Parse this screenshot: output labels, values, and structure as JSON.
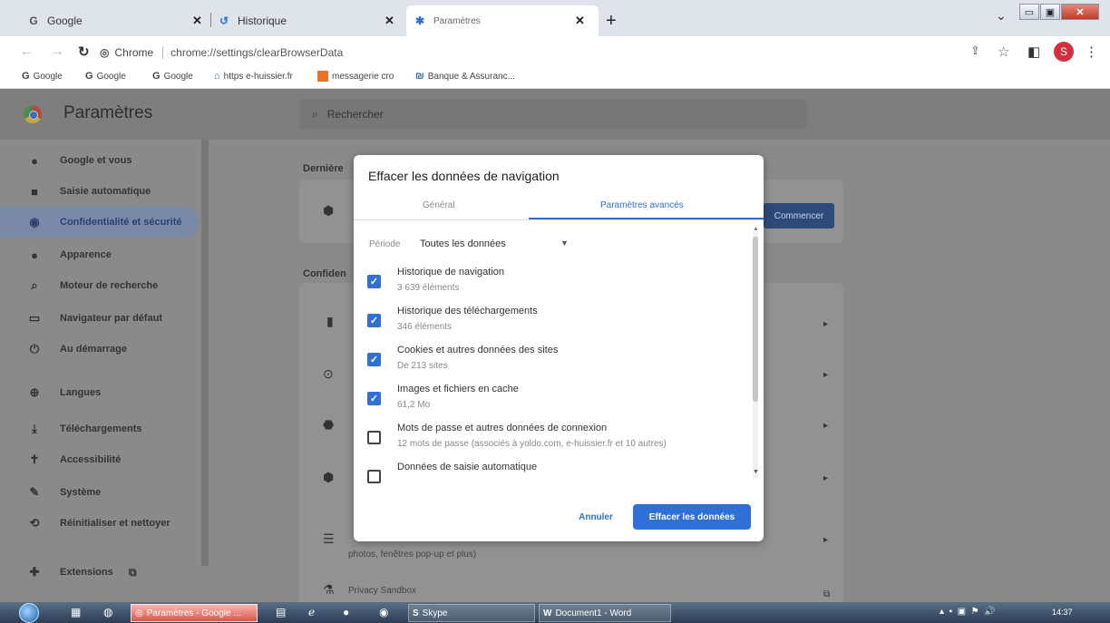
{
  "tabs": [
    {
      "title": "Google",
      "icon": "google-icon"
    },
    {
      "title": "Historique",
      "icon": "history-icon"
    },
    {
      "title": "Paramètres",
      "icon": "gear-icon"
    }
  ],
  "omnibox": {
    "site": "Chrome",
    "url": "chrome://settings/clearBrowserData"
  },
  "profile": {
    "initial": "S"
  },
  "bookmarks": [
    {
      "label": "Google"
    },
    {
      "label": "Google"
    },
    {
      "label": "Google"
    },
    {
      "label": "https e-huissier.fr"
    },
    {
      "label": "messagerie cro"
    },
    {
      "label": "Banque & Assuranc..."
    }
  ],
  "settings": {
    "title": "Paramètres",
    "search_placeholder": "Rechercher",
    "nav": [
      {
        "label": "Google et vous",
        "icon": "person-icon"
      },
      {
        "label": "Saisie automatique",
        "icon": "clipboard-icon"
      },
      {
        "label": "Confidentialité et sécurité",
        "icon": "shield-icon"
      },
      {
        "label": "Apparence",
        "icon": "palette-icon"
      },
      {
        "label": "Moteur de recherche",
        "icon": "search-icon"
      },
      {
        "label": "Navigateur par défaut",
        "icon": "browser-icon"
      },
      {
        "label": "Au démarrage",
        "icon": "power-icon"
      },
      {
        "label": "Langues",
        "icon": "globe-icon"
      },
      {
        "label": "Téléchargements",
        "icon": "download-icon"
      },
      {
        "label": "Accessibilité",
        "icon": "accessibility-icon"
      },
      {
        "label": "Système",
        "icon": "wrench-icon"
      },
      {
        "label": "Réinitialiser et nettoyer",
        "icon": "reset-icon"
      },
      {
        "label": "Extensions",
        "icon": "puzzle-icon"
      }
    ],
    "sections": [
      {
        "title": "Dernière"
      },
      {
        "title": "Confiden"
      }
    ],
    "bg_button": "Commencer",
    "bg_texts": [
      "photos, fenêtres pop-up et plus)",
      "Privacy Sandbox"
    ]
  },
  "dialog": {
    "title": "Effacer les données de navigation",
    "tab_basic": "Général",
    "tab_advanced": "Paramètres avancés",
    "period_label": "Période",
    "period_value": "Toutes les données",
    "items": [
      {
        "label": "Historique de navigation",
        "desc": "3 639 éléments",
        "checked": true
      },
      {
        "label": "Historique des téléchargements",
        "desc": "346 éléments",
        "checked": true
      },
      {
        "label": "Cookies et autres données des sites",
        "desc": "De 213 sites",
        "checked": true
      },
      {
        "label": "Images et fichiers en cache",
        "desc": "61,2 Mo",
        "checked": true
      },
      {
        "label": "Mots de passe et autres données de connexion",
        "desc": "12 mots de passe (associés à yoldo.com, e-huissier.fr et 10 autres)",
        "checked": false
      },
      {
        "label": "Données de saisie automatique",
        "desc": "",
        "checked": false
      }
    ],
    "cancel_label": "Annuler",
    "confirm_label": "Effacer les données",
    "accent": "#2f6fd6"
  },
  "taskbar": {
    "items": [
      {
        "label": "Paramètres - Google ..."
      },
      {
        "label": "Skype"
      },
      {
        "label": "Document1 - Word"
      }
    ],
    "clock": "14:37"
  }
}
